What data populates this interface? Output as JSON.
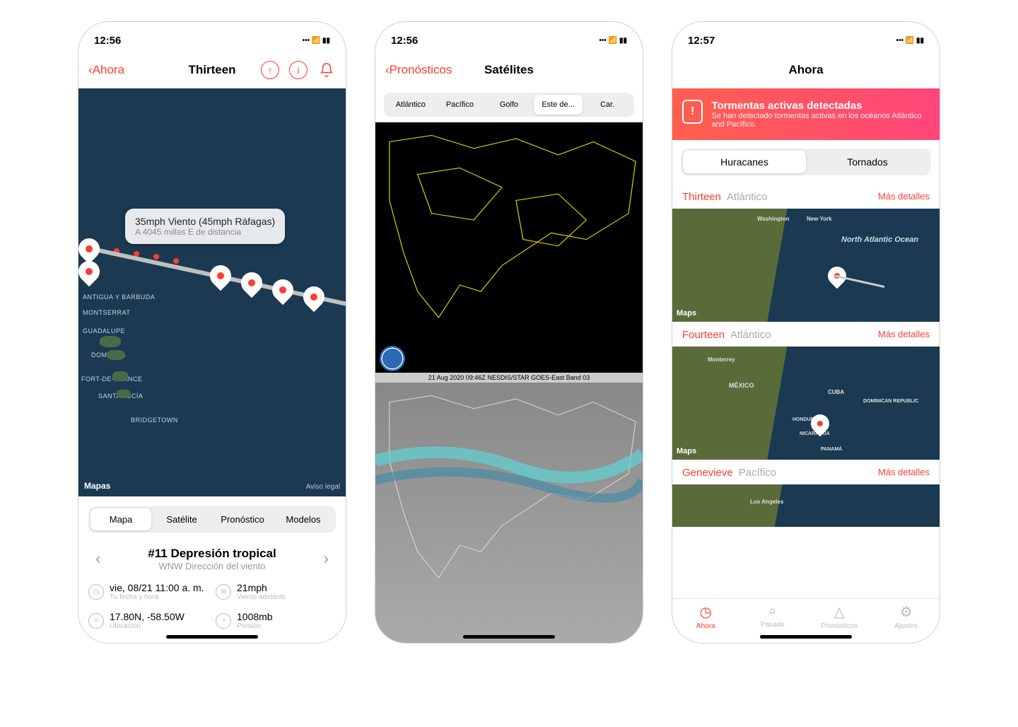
{
  "statusbar": {
    "time_1": "12:56",
    "time_2": "12:56",
    "time_3": "12:57",
    "loc_arrow": "◤"
  },
  "phone1": {
    "back_label": "Ahora",
    "title": "Thirteen",
    "callout_main": "35mph Viento (45mph Ráfagas)",
    "callout_sub": "A 4045 millas E de distancia",
    "maps_credit": "Mapas",
    "aviso": "Aviso legal",
    "islands": [
      "ANTIGUA Y BARBUDA",
      "MONTSERRAT",
      "GUADALUPE",
      "DOMINICA",
      "Fort-de-France",
      "SANTA LUCÍA",
      "Bridgetown"
    ],
    "seg": [
      "Mapa",
      "Satélite",
      "Pronóstico",
      "Modelos"
    ],
    "storm_name": "#11 Depresión tropical",
    "storm_dir": "WNW Dirección del viento",
    "stats": {
      "time_v": "vie, 08/21 11:00 a. m.",
      "time_l": "Tu fecha y hora",
      "wind_v": "21mph",
      "wind_l": "Viento adelante",
      "loc_v": "17.80N, -58.50W",
      "loc_l": "Ubicación",
      "pres_v": "1008mb",
      "pres_l": "Presión"
    }
  },
  "phone2": {
    "back_label": "Pronósticos",
    "title": "Satélites",
    "seg": [
      "Atlántico",
      "Pacífico",
      "Golfo",
      "Este de...",
      "Car."
    ],
    "caption": "21 Aug 2020 09:46Z NESDIS/STAR GOES-East Band 03"
  },
  "phone3": {
    "title": "Ahora",
    "alert_title": "Tormentas activas detectadas",
    "alert_sub": "Se han detectado tormentas activas en los océanos Atlántico and Pacífico.",
    "seg": [
      "Huracanes",
      "Tornados"
    ],
    "storms": [
      {
        "name": "Thirteen",
        "ocean": "Atlántico",
        "more": "Más detalles"
      },
      {
        "name": "Fourteen",
        "ocean": "Atlántico",
        "more": "Más detalles"
      },
      {
        "name": "Genevieve",
        "ocean": "Pacífico",
        "more": "Más detalles"
      }
    ],
    "maps_credit": "Maps",
    "map_labels": {
      "na_ocean": "North Atlantic Ocean",
      "washington": "Washington",
      "newyork": "New York",
      "mexico": "MÉXICO",
      "cuba": "CUBA",
      "dr": "DOMINICAN REPUBLIC",
      "hond": "HONDURAS",
      "nica": "NICARAGUA",
      "panama": "PANAMÁ",
      "monterrey": "Monterrey",
      "la": "Los Angeles"
    },
    "tabs": [
      "Ahora",
      "Pasado",
      "Pronósticos",
      "Ajustes"
    ]
  }
}
